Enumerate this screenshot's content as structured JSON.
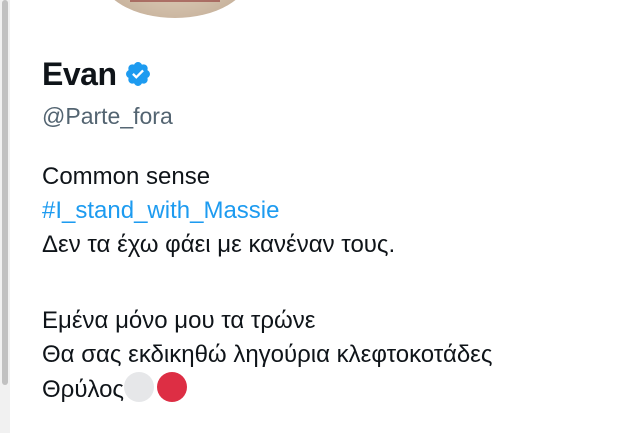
{
  "profile": {
    "display_name": "Evan",
    "handle": "@Parte_fora",
    "verified_color": "#1d9bf0",
    "bio": {
      "line1": "Common sense",
      "hashtag": "#I_stand_with_Massie",
      "line3": "Δεν τα έχω φάει με κανέναν τους.",
      "line4": "Εμένα μόνο μου τα τρώνε",
      "line5": "Θα σας εκδικηθώ ληγούρια κλεφτοκοτάδες",
      "line6": "Θρύλος",
      "emoji": [
        "white-circle",
        "red-circle"
      ]
    }
  }
}
